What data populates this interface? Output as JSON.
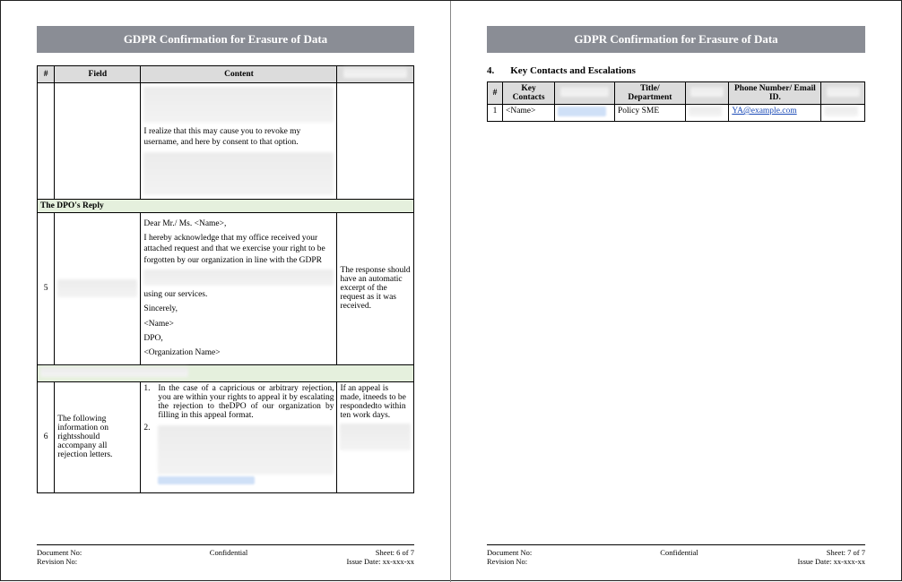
{
  "doc_title": "GDPR Confirmation for Erasure of Data",
  "page_left": {
    "table_headers": {
      "num": "#",
      "field": "Field",
      "content": "Content",
      "note": ""
    },
    "row_top": {
      "para1": "I realize that this may cause you to revoke my username, and here by consent to that option."
    },
    "green1": "The DPO's Reply",
    "row5": {
      "num": "5",
      "salutation": "Dear Mr./ Ms. <Name>,",
      "body": "I hereby acknowledge that my office received your attached request and that we exercise your right to be forgotten by our organization in line with the GDPR",
      "line2": "using our services.",
      "sig1": "Sincerely,",
      "sig2": "<Name>",
      "sig3": "DPO,",
      "sig4": "<Organization Name>",
      "note": "The response should have an automatic excerpt of the request as it was received."
    },
    "row6": {
      "num": "6",
      "field": "The following information on rightsshould accompany all rejection letters.",
      "item1_num": "1.",
      "item1": "In the case of a capricious or arbitrary rejection, you are within your rights to appeal it by escalating the rejection to theDPO of our organization by filling in this appeal format.",
      "item2_num": "2.",
      "note": "If an appeal is made, itneeds to be respondedto within ten work days."
    },
    "footer": {
      "docno": "Document No:",
      "conf": "Confidential",
      "sheet": "Sheet: 6 of 7",
      "rev": "Revision No:",
      "issue": "Issue Date: xx-xxx-xx"
    }
  },
  "page_right": {
    "section_num": "4.",
    "section_title": "Key Contacts and Escalations",
    "table_headers": {
      "num": "#",
      "key": "Key Contacts",
      "col2": "",
      "title": "Title/ Department",
      "col4": "",
      "phone": "Phone Number/ Email ID.",
      "col6": ""
    },
    "row1": {
      "num": "1",
      "name": "<Name>",
      "title": "Policy SME",
      "email": "YA@example.com"
    },
    "footer": {
      "docno": "Document No:",
      "conf": "Confidential",
      "sheet": "Sheet: 7 of 7",
      "rev": "Revision No:",
      "issue": "Issue Date: xx-xxx-xx"
    }
  }
}
